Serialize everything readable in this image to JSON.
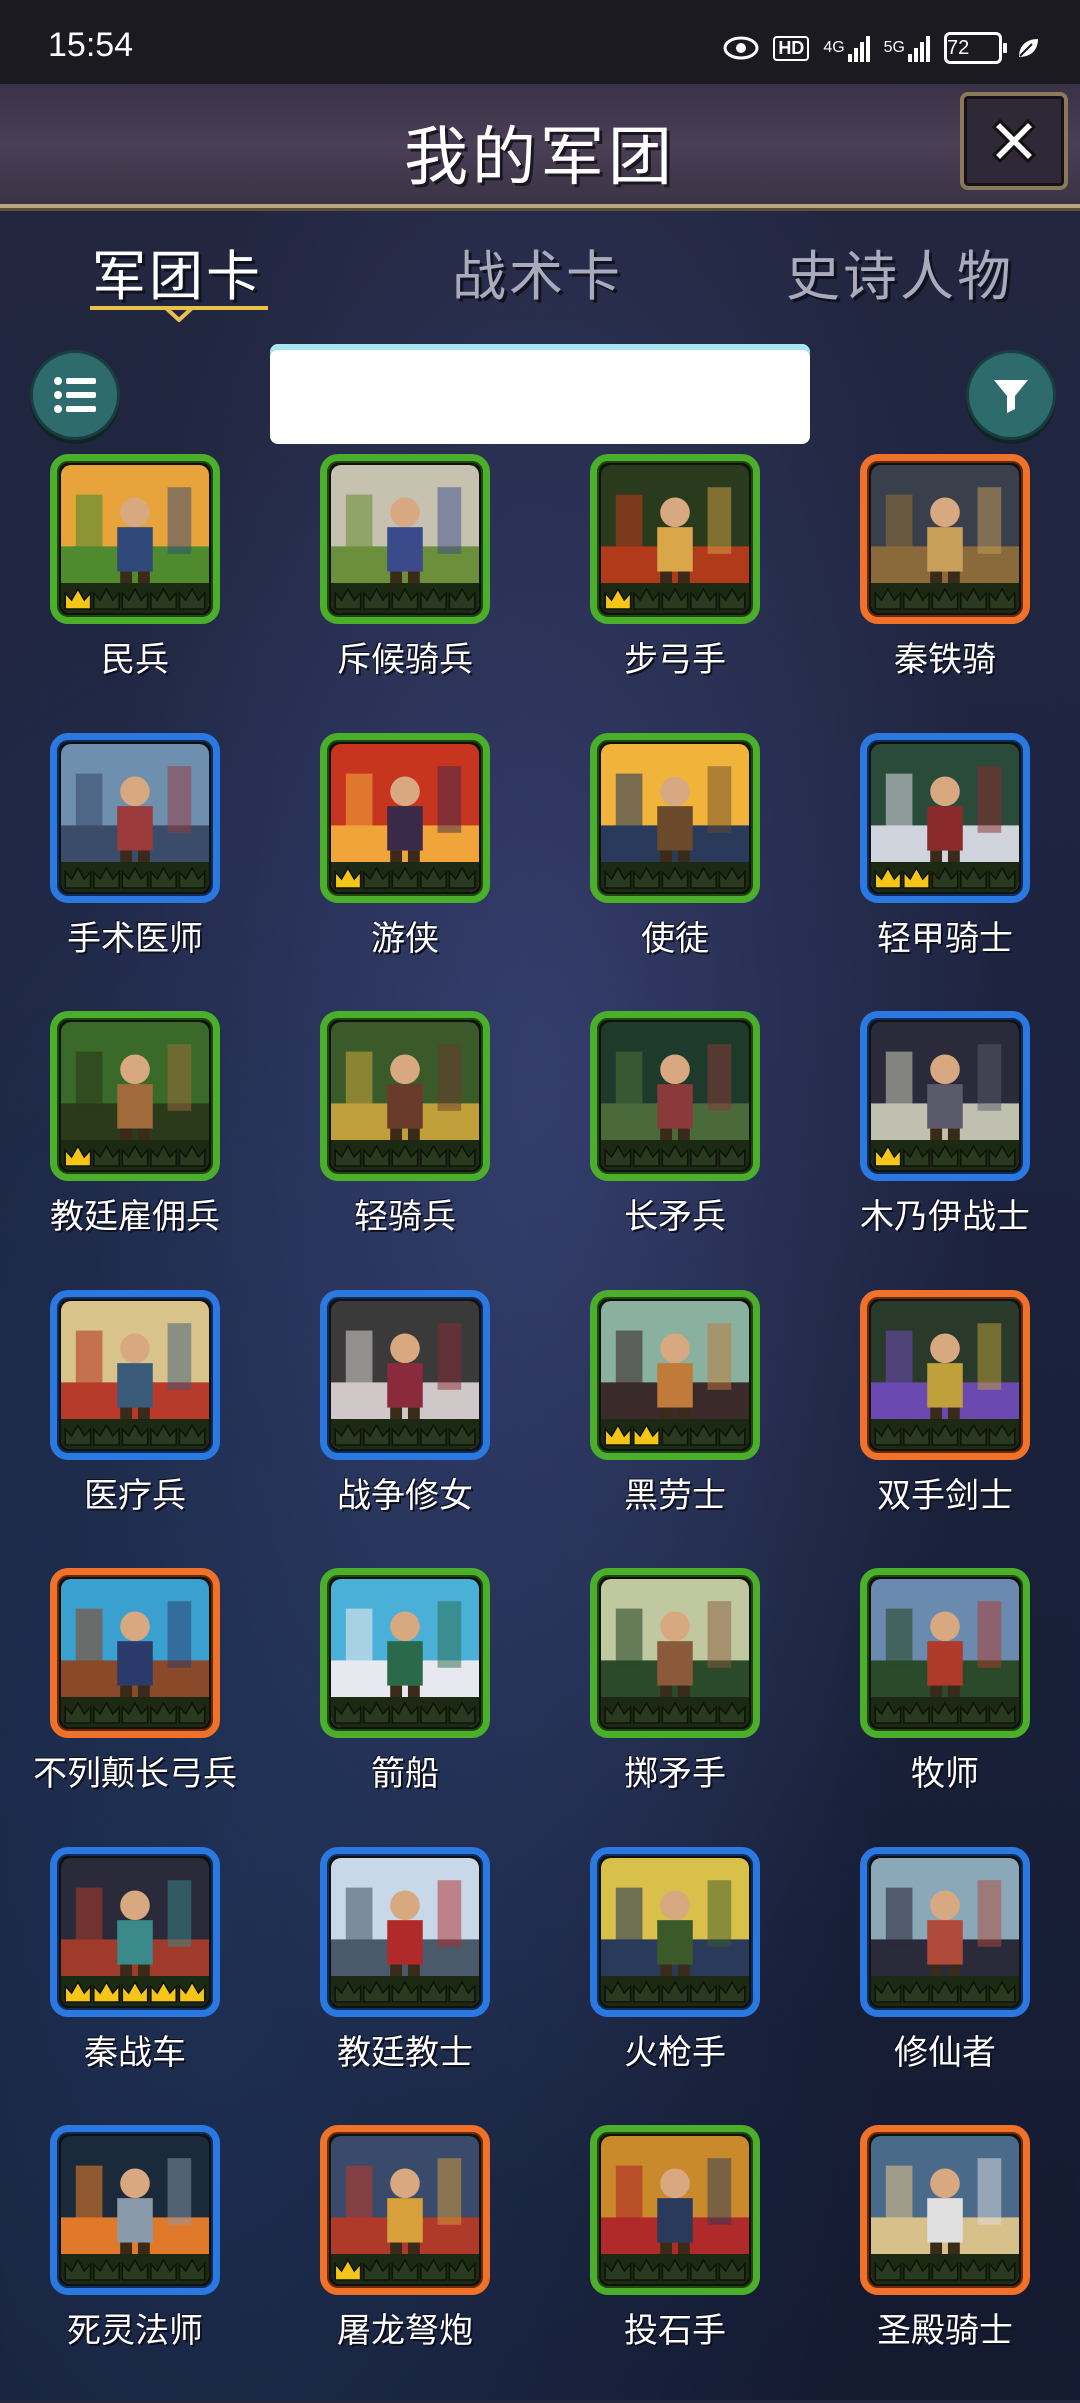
{
  "status_bar": {
    "time": "15:54",
    "hd": "HD",
    "net1": "4G",
    "net2": "5G",
    "battery": "72"
  },
  "header": {
    "title": "我的军团"
  },
  "tabs": [
    {
      "label": "军团卡",
      "active": true
    },
    {
      "label": "战术卡",
      "active": false
    },
    {
      "label": "史诗人物",
      "active": false
    }
  ],
  "search": {
    "value": "",
    "placeholder": ""
  },
  "colors": {
    "green": "#4caf2b",
    "blue": "#2a78e0",
    "orange": "#f0722a",
    "button": "#2e6b6c"
  },
  "cards": [
    {
      "name": "民兵",
      "rarity": "green",
      "crowns": 1
    },
    {
      "name": "斥候骑兵",
      "rarity": "green",
      "crowns": 0
    },
    {
      "name": "步弓手",
      "rarity": "green",
      "crowns": 1
    },
    {
      "name": "秦铁骑",
      "rarity": "orange",
      "crowns": 0
    },
    {
      "name": "手术医师",
      "rarity": "blue",
      "crowns": 0
    },
    {
      "name": "游侠",
      "rarity": "green",
      "crowns": 1
    },
    {
      "name": "使徒",
      "rarity": "green",
      "crowns": 0
    },
    {
      "name": "轻甲骑士",
      "rarity": "blue",
      "crowns": 2
    },
    {
      "name": "教廷雇佣兵",
      "rarity": "green",
      "crowns": 1
    },
    {
      "name": "轻骑兵",
      "rarity": "green",
      "crowns": 0
    },
    {
      "name": "长矛兵",
      "rarity": "green",
      "crowns": 0
    },
    {
      "name": "木乃伊战士",
      "rarity": "blue",
      "crowns": 1
    },
    {
      "name": "医疗兵",
      "rarity": "blue",
      "crowns": 0
    },
    {
      "name": "战争修女",
      "rarity": "blue",
      "crowns": 0
    },
    {
      "name": "黑劳士",
      "rarity": "green",
      "crowns": 2
    },
    {
      "name": "双手剑士",
      "rarity": "orange",
      "crowns": 0
    },
    {
      "name": "不列颠长弓兵",
      "rarity": "orange",
      "crowns": 0
    },
    {
      "name": "箭船",
      "rarity": "green",
      "crowns": 0
    },
    {
      "name": "掷矛手",
      "rarity": "green",
      "crowns": 0
    },
    {
      "name": "牧师",
      "rarity": "green",
      "crowns": 0
    },
    {
      "name": "秦战车",
      "rarity": "blue",
      "crowns": 5
    },
    {
      "name": "教廷教士",
      "rarity": "blue",
      "crowns": 0
    },
    {
      "name": "火枪手",
      "rarity": "blue",
      "crowns": 0
    },
    {
      "name": "修仙者",
      "rarity": "blue",
      "crowns": 0
    },
    {
      "name": "死灵法师",
      "rarity": "blue",
      "crowns": 0
    },
    {
      "name": "屠龙弩炮",
      "rarity": "orange",
      "crowns": 1
    },
    {
      "name": "投石手",
      "rarity": "green",
      "crowns": 0
    },
    {
      "name": "圣殿骑士",
      "rarity": "orange",
      "crowns": 0
    }
  ]
}
